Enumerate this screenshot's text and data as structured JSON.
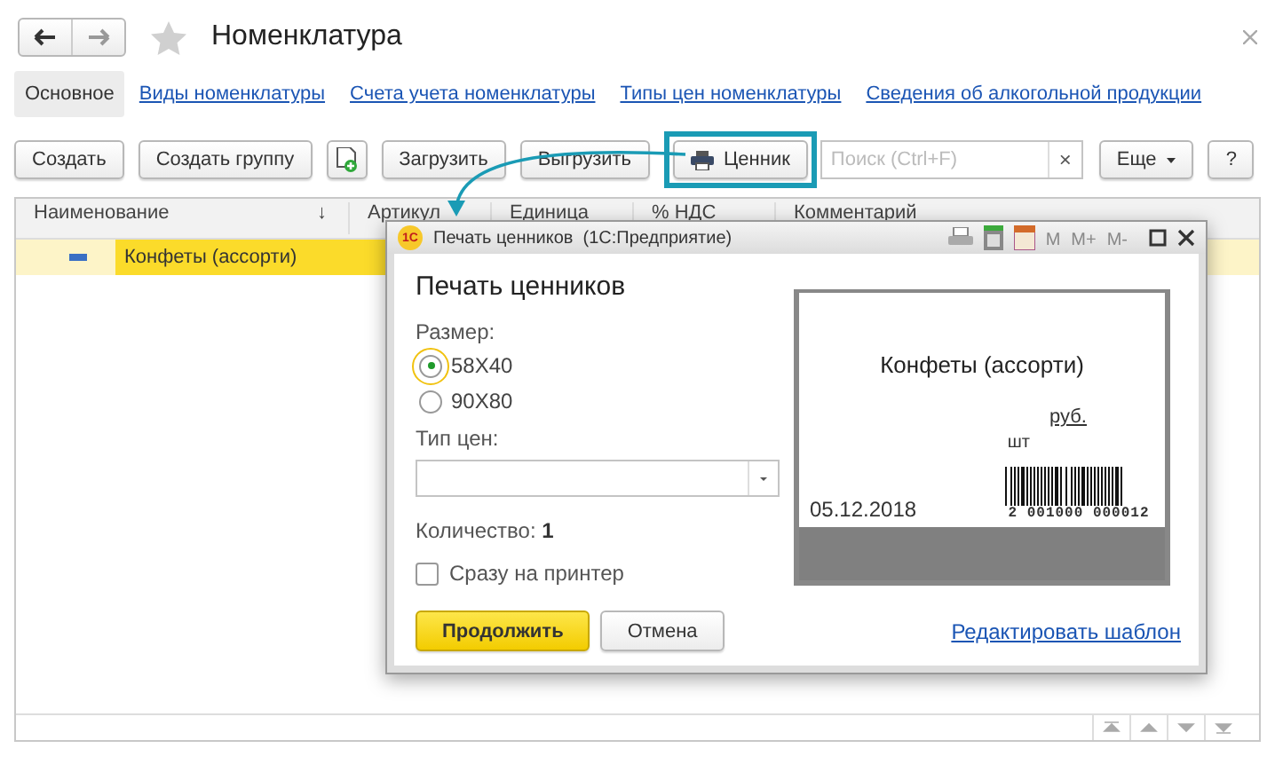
{
  "window": {
    "title": "Номенклатура"
  },
  "nav_tabs": [
    {
      "label": "Основное",
      "selected": true
    },
    {
      "label": "Виды номенклатуры",
      "selected": false
    },
    {
      "label": "Счета учета номенклатуры",
      "selected": false
    },
    {
      "label": "Типы цен номенклатуры",
      "selected": false
    },
    {
      "label": "Сведения об алкогольной продукции",
      "selected": false
    }
  ],
  "toolbar": [
    {
      "kind": "button",
      "label": "Создать"
    },
    {
      "kind": "button",
      "label": "Создать группу"
    },
    {
      "kind": "icon"
    },
    {
      "kind": "button",
      "label": "Загрузить"
    },
    {
      "kind": "button",
      "label": "Выгрузить"
    },
    {
      "kind": "print",
      "label": "Ценник",
      "highlighted": true
    },
    {
      "kind": "search",
      "placeholder": "Поиск (Ctrl+F)",
      "clear": "×"
    },
    {
      "kind": "more",
      "label": "Еще"
    },
    {
      "kind": "button",
      "label": "?"
    }
  ],
  "table": {
    "columns": [
      {
        "label": "Наименование",
        "sort_mark": "↓"
      },
      {
        "label": "Артикул"
      },
      {
        "label": "Единица"
      },
      {
        "label": "% НДС"
      },
      {
        "label": "Комментарий"
      }
    ],
    "rows": [
      {
        "name": "Конфеты (ассорти)",
        "selected": true
      }
    ]
  },
  "dialog": {
    "logo": "1С",
    "title": "Печать ценников  (1С:Предприятие)",
    "memory_buttons": [
      "M",
      "M+",
      "M-"
    ],
    "heading": "Печать ценников",
    "size_label": "Размер:",
    "size_options": [
      {
        "label": "58X40",
        "selected": true
      },
      {
        "label": "90X80",
        "selected": false
      }
    ],
    "price_type_label": "Тип цен:",
    "quantity_label": "Количество:",
    "quantity": "1",
    "checkbox": {
      "label": "Сразу на принтер",
      "checked": false
    },
    "buttons": [
      {
        "kind": "primary",
        "label": "Продолжить"
      },
      {
        "kind": "default",
        "label": "Отмена"
      }
    ],
    "preview": {
      "name": "Конфеты (ассорти)",
      "currency": "руб.",
      "unit": "шт",
      "date": "05.12.2018",
      "barcode": "2 001000 000012"
    },
    "edit_link": "Редактировать шаблон"
  }
}
